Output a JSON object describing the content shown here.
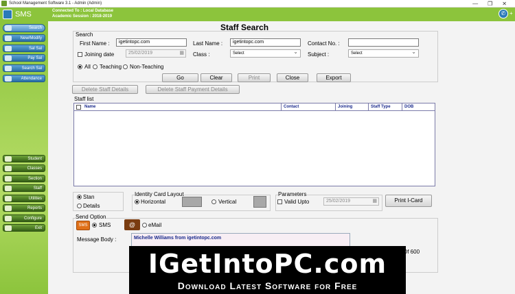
{
  "window": {
    "title": "School Management Software 3.1 - Admin (Admin)",
    "controls": [
      "—",
      "❐",
      "✕"
    ]
  },
  "header": {
    "app_name": "SMS",
    "connected": "Connected To : Local Database",
    "session": "Academic Session : 2018-2019",
    "plus": "+"
  },
  "sidebar": {
    "top_items": [
      "Search",
      "New/Modify",
      "Sal Sal",
      "Pay Sal",
      "Search Sal",
      "Attendance"
    ],
    "bottom_items": [
      "Student",
      "Classes",
      "Section",
      "Staff",
      "Utilities",
      "Reports",
      "Configure",
      "Exit"
    ]
  },
  "page": {
    "title": "Staff Search"
  },
  "search": {
    "group_label": "Search",
    "first_name_label": "First Name :",
    "first_name_value": "igetintopc.com",
    "last_name_label": "Last Name :",
    "last_name_value": "igetintopc.com",
    "contact_label": "Contact No. :",
    "contact_value": "",
    "joining_label": "Joining date",
    "joining_value": "25/02/2019",
    "class_label": "Class :",
    "class_value": "Select",
    "subject_label": "Subject :",
    "subject_value": "Select",
    "filter_all": "All",
    "filter_teaching": "Teaching",
    "filter_non_teaching": "Non-Teaching"
  },
  "actions": {
    "go": "Go",
    "clear": "Clear",
    "print": "Print",
    "close": "Close",
    "export": "Export"
  },
  "delete": {
    "staff": "Delete Staff Details",
    "payment": "Delete Staff Payment Details"
  },
  "staff_list": {
    "label": "Staff list",
    "columns": [
      "Name",
      "Contact",
      "Joining",
      "Staff Type",
      "DOB"
    ]
  },
  "view": {
    "stan": "Stan",
    "details": "Details"
  },
  "id_card": {
    "label": "Identity Card Layout",
    "horizontal": "Horizontal",
    "vertical": "Vertical"
  },
  "parameters": {
    "label": "Parameters",
    "valid_upto": "Valid Upto",
    "valid_value": "25/02/2019",
    "print_card": "Print I-Card"
  },
  "send": {
    "label": "Send Option",
    "sms_icon": "SMS",
    "sms": "SMS",
    "email": "eMail",
    "message_label": "Message Body :",
    "message_value": "Michelle Williams from igetintopc.com",
    "chars_left": "rs Out Of 600"
  },
  "banner": {
    "title": "IGetIntoPC.com",
    "subtitle": "Download Latest Software for Free"
  }
}
